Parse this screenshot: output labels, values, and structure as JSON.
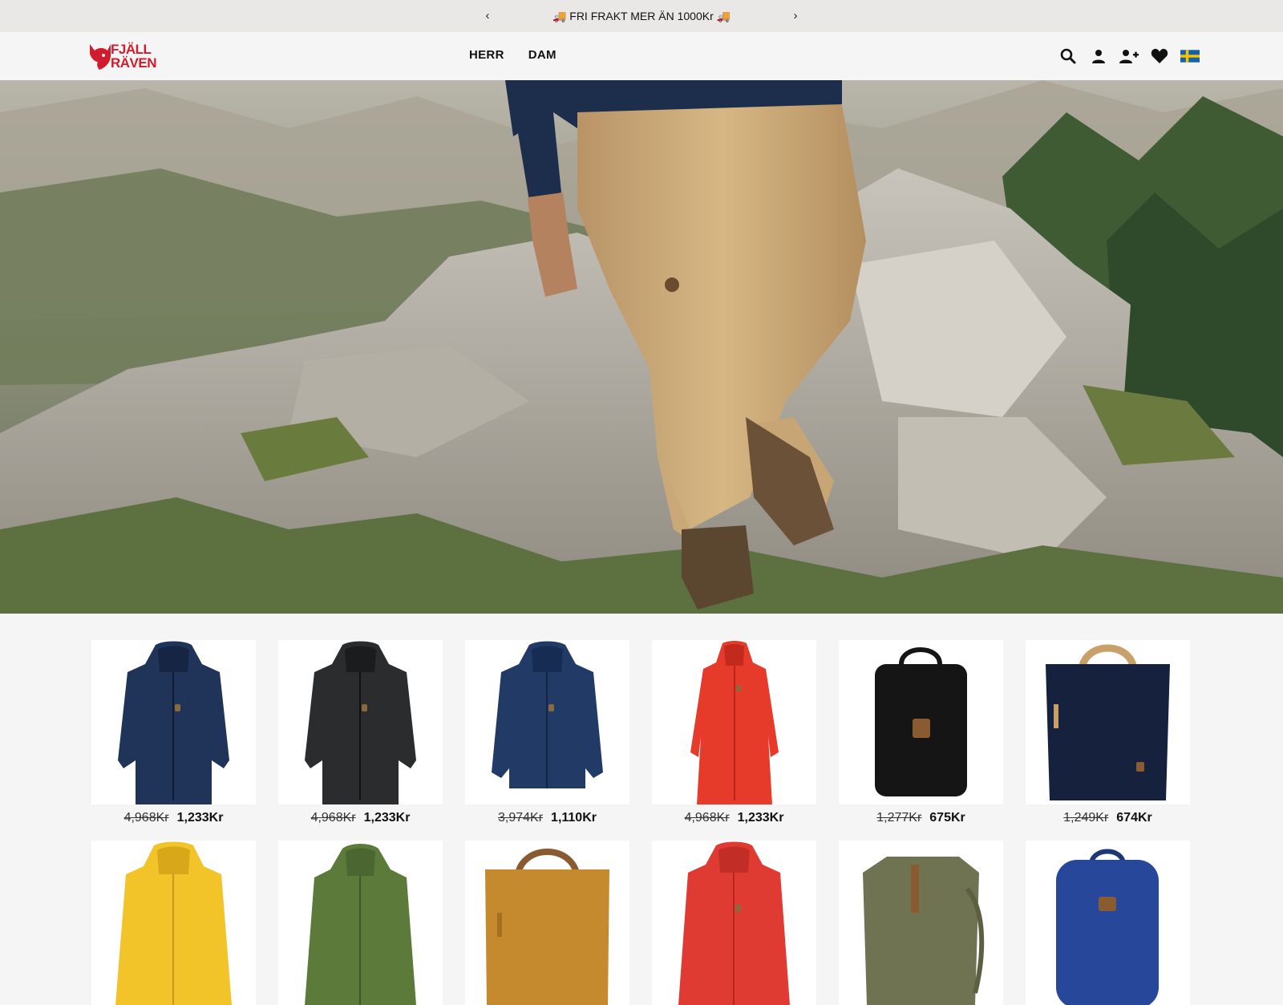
{
  "promo": {
    "message": "🚚 FRI FRAKT MER ÄN 1000Kr 🚚",
    "prev_icon": "chevron-left-icon",
    "next_icon": "chevron-right-icon",
    "prev_glyph": "‹",
    "next_glyph": "›"
  },
  "header": {
    "logo_line1": "FJÄLL",
    "logo_line2": "RÄVEN",
    "nav": [
      {
        "label": "HERR"
      },
      {
        "label": "DAM"
      }
    ],
    "tools": [
      "search-icon",
      "account-icon",
      "register-icon",
      "wishlist-icon",
      "swedish-flag-icon"
    ]
  },
  "colors": {
    "brand": "#d21b2c",
    "promo_bg": "#e9e8e7",
    "page_bg": "#f5f5f5"
  },
  "products": [
    {
      "name": "navy-down-parka",
      "old_price": "4,968Kr",
      "price": "1,233Kr",
      "color": "#1f3458"
    },
    {
      "name": "black-down-parka",
      "old_price": "4,968Kr",
      "price": "1,233Kr",
      "color": "#2a2c2e"
    },
    {
      "name": "navy-down-jacket",
      "old_price": "3,974Kr",
      "price": "1,110Kr",
      "color": "#213a66"
    },
    {
      "name": "red-long-down-coat",
      "old_price": "4,968Kr",
      "price": "1,233Kr",
      "color": "#e63a2b"
    },
    {
      "name": "black-backpack",
      "old_price": "1,277Kr",
      "price": "675Kr",
      "color": "#151515"
    },
    {
      "name": "navy-tote-pack",
      "old_price": "1,249Kr",
      "price": "674Kr",
      "color": "#15213d"
    },
    {
      "name": "yellow-down-jacket",
      "old_price": "",
      "price": "",
      "color": "#f2c42a"
    },
    {
      "name": "green-field-jacket",
      "old_price": "",
      "price": "",
      "color": "#5c7a3a"
    },
    {
      "name": "ochre-tote-bag",
      "old_price": "",
      "price": "",
      "color": "#c58a2d"
    },
    {
      "name": "red-down-jacket",
      "old_price": "",
      "price": "",
      "color": "#df3b32"
    },
    {
      "name": "olive-rolltop-backpack",
      "old_price": "",
      "price": "",
      "color": "#6f7352"
    },
    {
      "name": "blue-backpack",
      "old_price": "",
      "price": "",
      "color": "#26479a"
    }
  ]
}
